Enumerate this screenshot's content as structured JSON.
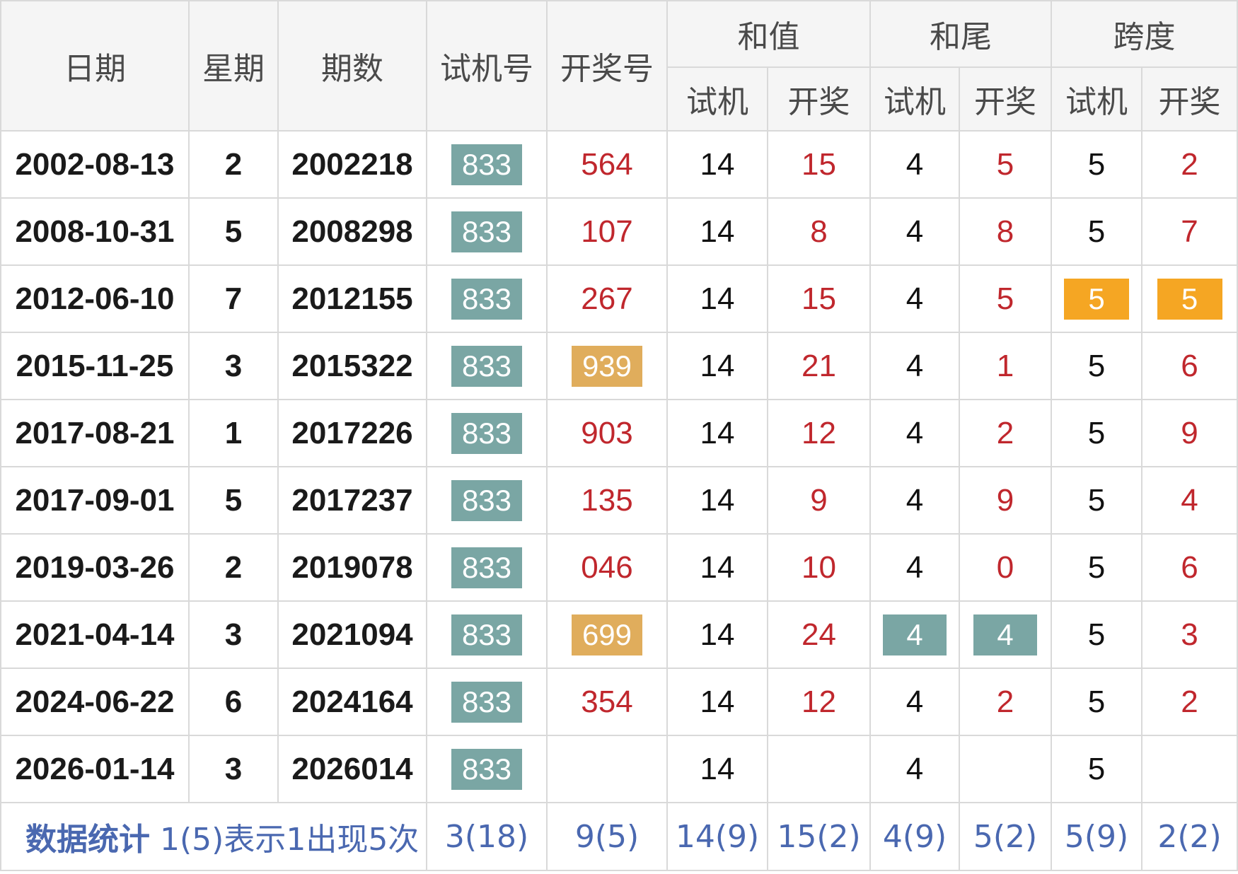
{
  "headers": {
    "date": "日期",
    "weekday": "星期",
    "issue": "期数",
    "test_number": "试机号",
    "draw_number": "开奖号",
    "sum": "和值",
    "sum_tail": "和尾",
    "span": "跨度",
    "sub": {
      "sum_test": "试机",
      "sum_draw": "开奖",
      "tail_test": "试机",
      "tail_draw": "开奖",
      "span_test": "试机",
      "span_draw": "开奖"
    }
  },
  "colors": {
    "teal_chip": "#7aa6a4",
    "gold_chip": "#e0ad5c",
    "orange_chip": "#f5a623",
    "red_text": "#c0272d",
    "stats_blue": "#4a68b0"
  },
  "rows": [
    {
      "date": "2002-08-13",
      "weekday": "2",
      "issue": "2002218",
      "test": "833",
      "draw": "564",
      "sum_test": "14",
      "sum_draw": "15",
      "tail_test": "4",
      "tail_draw": "5",
      "span_test": "5",
      "span_draw": "2"
    },
    {
      "date": "2008-10-31",
      "weekday": "5",
      "issue": "2008298",
      "test": "833",
      "draw": "107",
      "sum_test": "14",
      "sum_draw": "8",
      "tail_test": "4",
      "tail_draw": "8",
      "span_test": "5",
      "span_draw": "7"
    },
    {
      "date": "2012-06-10",
      "weekday": "7",
      "issue": "2012155",
      "test": "833",
      "draw": "267",
      "sum_test": "14",
      "sum_draw": "15",
      "tail_test": "4",
      "tail_draw": "5",
      "span_test": "5",
      "span_draw": "5"
    },
    {
      "date": "2015-11-25",
      "weekday": "3",
      "issue": "2015322",
      "test": "833",
      "draw": "939",
      "sum_test": "14",
      "sum_draw": "21",
      "tail_test": "4",
      "tail_draw": "1",
      "span_test": "5",
      "span_draw": "6"
    },
    {
      "date": "2017-08-21",
      "weekday": "1",
      "issue": "2017226",
      "test": "833",
      "draw": "903",
      "sum_test": "14",
      "sum_draw": "12",
      "tail_test": "4",
      "tail_draw": "2",
      "span_test": "5",
      "span_draw": "9"
    },
    {
      "date": "2017-09-01",
      "weekday": "5",
      "issue": "2017237",
      "test": "833",
      "draw": "135",
      "sum_test": "14",
      "sum_draw": "9",
      "tail_test": "4",
      "tail_draw": "9",
      "span_test": "5",
      "span_draw": "4"
    },
    {
      "date": "2019-03-26",
      "weekday": "2",
      "issue": "2019078",
      "test": "833",
      "draw": "046",
      "sum_test": "14",
      "sum_draw": "10",
      "tail_test": "4",
      "tail_draw": "0",
      "span_test": "5",
      "span_draw": "6"
    },
    {
      "date": "2021-04-14",
      "weekday": "3",
      "issue": "2021094",
      "test": "833",
      "draw": "699",
      "sum_test": "14",
      "sum_draw": "24",
      "tail_test": "4",
      "tail_draw": "4",
      "span_test": "5",
      "span_draw": "3"
    },
    {
      "date": "2024-06-22",
      "weekday": "6",
      "issue": "2024164",
      "test": "833",
      "draw": "354",
      "sum_test": "14",
      "sum_draw": "12",
      "tail_test": "4",
      "tail_draw": "2",
      "span_test": "5",
      "span_draw": "2"
    },
    {
      "date": "2026-01-14",
      "weekday": "3",
      "issue": "2026014",
      "test": "833",
      "draw": "",
      "sum_test": "14",
      "sum_draw": "",
      "tail_test": "4",
      "tail_draw": "",
      "span_test": "5",
      "span_draw": ""
    }
  ],
  "stats": {
    "label": "数据统计",
    "note": "1(5)表示1出现5次",
    "test": "3(18)",
    "draw": "9(5)",
    "sum_test": "14(9)",
    "sum_draw": "15(2)",
    "tail_test": "4(9)",
    "tail_draw": "5(2)",
    "span_test": "5(9)",
    "span_draw": "2(2)"
  }
}
